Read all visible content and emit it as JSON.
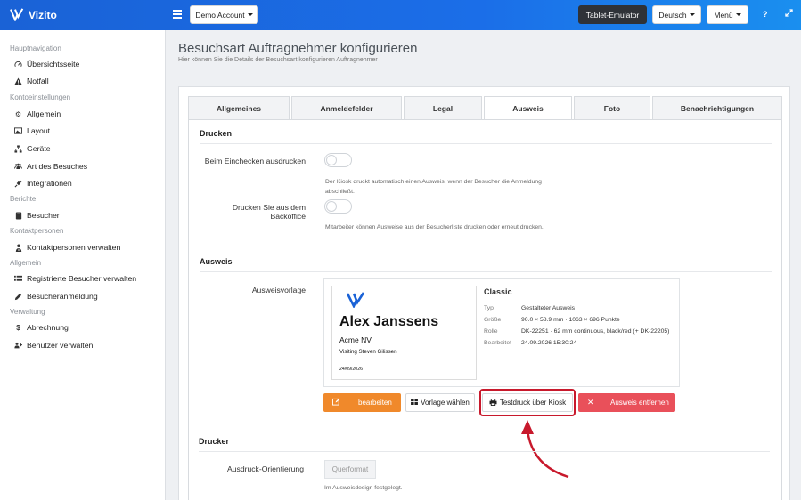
{
  "brand": {
    "name": "Vizito"
  },
  "topbar": {
    "account_label": "Demo Account",
    "tablet_label": "Tablet-Emulator",
    "language_label": "Deutsch",
    "menu_label": "Menü",
    "help_icon": "question-icon",
    "expand_icon": "expand-icon"
  },
  "sidebar": {
    "sections": [
      {
        "title": "Hauptnavigation",
        "items": [
          {
            "label": "Übersichtsseite",
            "icon": "gauge-icon"
          },
          {
            "label": "Notfall",
            "icon": "warning-icon"
          }
        ]
      },
      {
        "title": "Kontoeinstellungen",
        "items": [
          {
            "label": "Allgemein",
            "icon": "gear-icon"
          },
          {
            "label": "Layout",
            "icon": "image-icon"
          },
          {
            "label": "Geräte",
            "icon": "sitemap-icon"
          },
          {
            "label": "Art des Besuches",
            "icon": "users-icon"
          },
          {
            "label": "Integrationen",
            "icon": "plug-icon"
          }
        ]
      },
      {
        "title": "Berichte",
        "items": [
          {
            "label": "Besucher",
            "icon": "book-icon"
          }
        ]
      },
      {
        "title": "Kontaktpersonen",
        "items": [
          {
            "label": "Kontaktpersonen verwalten",
            "icon": "user-tie-icon"
          }
        ]
      },
      {
        "title": "Allgemein",
        "items": [
          {
            "label": "Registrierte Besucher verwalten",
            "icon": "list-icon"
          },
          {
            "label": "Besucheranmeldung",
            "icon": "pencil-icon"
          }
        ]
      },
      {
        "title": "Verwaltung",
        "items": [
          {
            "label": "Abrechnung",
            "icon": "dollar-icon"
          },
          {
            "label": "Benutzer verwalten",
            "icon": "user-plus-icon"
          }
        ]
      }
    ]
  },
  "header": {
    "title": "Besuchsart Auftragnehmer konfigurieren",
    "subtitle": "Hier können Sie die Details der Besuchsart konfigurieren Auftragnehmer"
  },
  "tabs": [
    {
      "label": "Allgemeines",
      "active": false
    },
    {
      "label": "Anmeldefelder",
      "active": false
    },
    {
      "label": "Legal",
      "active": false
    },
    {
      "label": "Ausweis",
      "active": true
    },
    {
      "label": "Foto",
      "active": false
    },
    {
      "label": "Benachrichtigungen",
      "active": false
    }
  ],
  "print_section": {
    "title": "Drucken",
    "checkin_label": "Beim Einchecken ausdrucken",
    "checkin_help": "Der Kiosk druckt automatisch einen Ausweis, wenn der Besucher die Anmeldung abschließt.",
    "backoffice_label": "Drucken Sie aus dem Backoffice",
    "backoffice_help": "Mitarbeiter können Ausweise aus der Besucherliste drucken oder erneut drucken."
  },
  "badge_section": {
    "title": "Ausweis",
    "template_label": "Ausweisvorlage",
    "preview": {
      "name": "Alex Janssens",
      "company": "Acme NV",
      "visiting": "Visiting Steven Gilissen",
      "date": "24/09/2026"
    },
    "meta": {
      "title": "Classic",
      "rows": [
        {
          "key": "Typ",
          "value": "Gestalteter Ausweis"
        },
        {
          "key": "Größe",
          "value": "90.0 × 58.9 mm · 1063 × 696 Punkte"
        },
        {
          "key": "Rolle",
          "value": "DK-22251 · 62 mm continuous, black/red (+ DK-22205)"
        },
        {
          "key": "Bearbeitet",
          "value": "24.09.2026 15:30:24"
        }
      ]
    },
    "actions": {
      "edit": "bearbeiten",
      "choose": "Vorlage wählen",
      "test_print": "Testdruck über Kiosk",
      "remove": "Ausweis entfernen"
    }
  },
  "printer_section": {
    "title": "Drucker",
    "orientation_label": "Ausdruck-Orientierung",
    "orientation_value": "Querformat",
    "orientation_help": "Im Ausweisdesign festgelegt."
  },
  "colors": {
    "topbar": "#1b6ee8",
    "edit_button": "#f0892b",
    "remove_button": "#e9505a",
    "highlight": "#c8192c"
  }
}
